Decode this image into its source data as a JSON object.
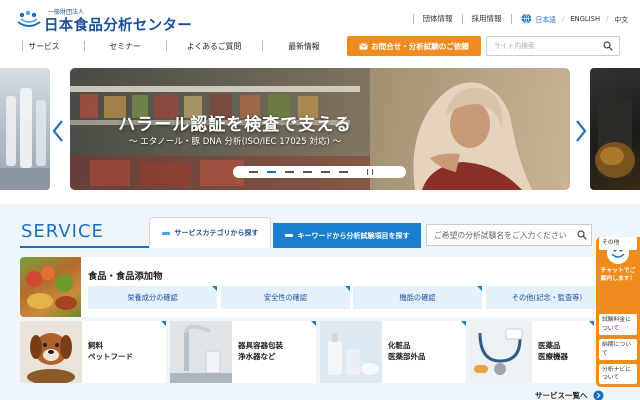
{
  "header": {
    "logo_sub": "一般財団法人",
    "logo_main": "日本食品分析センター",
    "top_links": [
      "団体情報",
      "採用情報"
    ],
    "languages": [
      "日本語",
      "ENGLISH",
      "中文"
    ],
    "active_language": "日本語",
    "icons": {
      "language": "globe-icon",
      "search": "search-icon",
      "mail": "mail-icon"
    }
  },
  "nav": {
    "items": [
      "サービス",
      "セミナー",
      "よくあるご質問",
      "最新情報"
    ],
    "contact_label": "お問合せ・分析試験のご依頼",
    "search_placeholder": "サイト内検索"
  },
  "carousel": {
    "title": "ハラール認証を検査で支える",
    "subtitle": "〜 エタノール・豚 DNA 分析(ISO/IEC 17025 対応) 〜",
    "slide_count": 6,
    "active_slide": 2
  },
  "service": {
    "heading": "SERVICE",
    "tab_category": "サービスカテゴリから探す",
    "tab_keyword": "キーワードから分析試験項目を探す",
    "keyword_placeholder": "ご希望の分析試験名をご入力ください",
    "food": {
      "title": "食品・食品添加物",
      "categories": [
        "栄養成分の確認",
        "安全性の確認",
        "機能の確認",
        "その他(記念・監査等)"
      ]
    },
    "cards": [
      {
        "label": "飼料\nペットフード"
      },
      {
        "label": "器具容器包装\n浄水器など"
      },
      {
        "label": "化粧品\n医薬部外品"
      },
      {
        "label": "医薬品\n医療機器"
      }
    ],
    "see_all": "サービス一覧へ"
  },
  "chat": {
    "heading": "チャットでご案内します！",
    "items": [
      "試験料金について",
      "納期について",
      "分析ナビについて",
      "その他"
    ]
  },
  "colors": {
    "brand_blue": "#1b6fc0",
    "accent_orange": "#f08c1e",
    "service_bg": "#eef5fb"
  }
}
